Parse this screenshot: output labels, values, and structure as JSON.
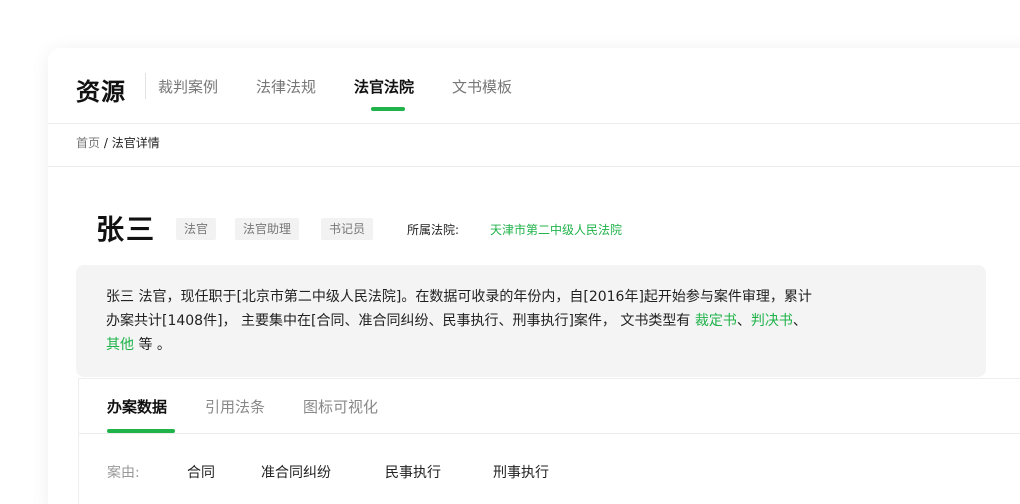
{
  "nav": {
    "logo": "资源",
    "tabs": [
      {
        "label": "裁判案例"
      },
      {
        "label": "法律法规"
      },
      {
        "label": "法官法院",
        "active": true
      },
      {
        "label": "文书模板"
      }
    ]
  },
  "breadcrumb": {
    "home": "首页",
    "separator": " / ",
    "current": "法官详情"
  },
  "profile": {
    "name": "张三",
    "tags": [
      "法官",
      "法官助理",
      "书记员"
    ],
    "court_label": "所属法院:",
    "court_name": "天津市第二中级人民法院"
  },
  "summary": {
    "line1": "张三 法官，现任职于[北京市第二中级人民法院]。在数据可收录的年份内，自[2016年]起开始参与案件审理，累计",
    "line2_prefix": "办案共计[1408件]， 主要集中在[合同、准合同纠纷、民事执行、刑事执行]案件， 文书类型有 ",
    "doc_type_1": "裁定书",
    "sep1": "、",
    "doc_type_2": "判决书",
    "sep2": "、",
    "doc_type_3": "其他",
    "suffix": " 等 。"
  },
  "subtabs": [
    {
      "label": "办案数据",
      "active": true
    },
    {
      "label": "引用法条"
    },
    {
      "label": "图标可视化"
    }
  ],
  "filter": {
    "label": "案由:",
    "options": [
      "合同",
      "准合同纠纷",
      "民事执行",
      "刑事执行"
    ]
  },
  "colors": {
    "accent": "#20b34a",
    "tag_bg": "#f2f2f2",
    "summary_bg": "#f4f4f4"
  }
}
